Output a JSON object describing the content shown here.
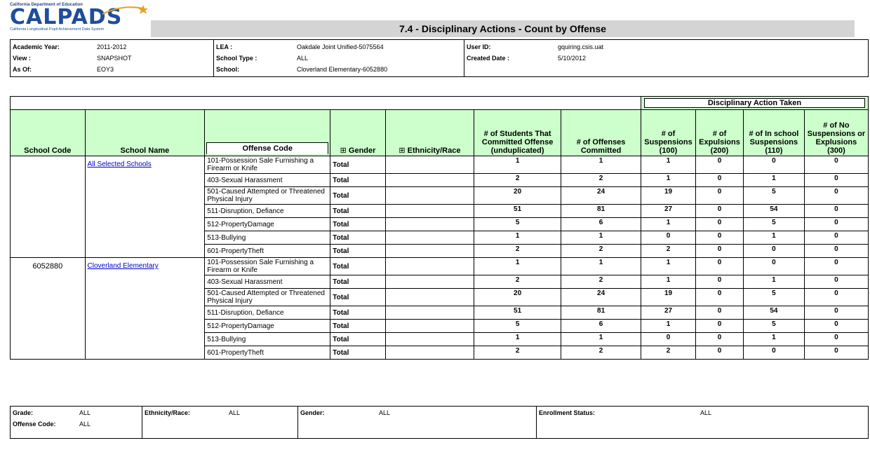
{
  "logo": {
    "dept": "California Department of Education",
    "word": "CALPADS",
    "sub": "California Longitudinal Pupil Achievement Data System"
  },
  "title": "7.4 - Disciplinary Actions - Count by Offense",
  "header": {
    "academic_year_label": "Academic Year:",
    "academic_year": "2011-2012",
    "view_label": "View :",
    "view": "SNAPSHOT",
    "as_of_label": "As Of:",
    "as_of": "EOY3",
    "lea_label": "LEA :",
    "lea": "Oakdale Joint Unified-5075564",
    "school_type_label": "School Type :",
    "school_type": "ALL",
    "school_label": "School:",
    "school": "Cloverland Elementary-6052880",
    "user_id_label": "User ID:",
    "user_id": "gquiring.csis.uat",
    "created_date_label": "Created Date :",
    "created_date": "5/10/2012"
  },
  "columns": {
    "school_code": "School Code",
    "school_name": "School Name",
    "offense_code": "Offense Code",
    "gender": "Gender",
    "ethnicity": "Ethnicity/Race",
    "students": "# of Students That Committed Offense (unduplicated)",
    "offenses": "# of Offenses Committed",
    "suspensions": "# of Suspensions (100)",
    "expulsions": "# of Expulsions (200)",
    "in_school": "# of In school Suspensions (110)",
    "no_susp": "# of No Suspensions or Explusions (300)",
    "group": "Disciplinary Action Taken",
    "expand_icon": "⊞"
  },
  "groups": [
    {
      "school_code": "",
      "school_name": "All Selected Schools",
      "rows": [
        {
          "offense": "101-Possession Sale Furnishing a Firearm or Knife",
          "gender": "Total",
          "students": "1",
          "offenses": "1",
          "suspensions": "1",
          "expulsions": "0",
          "in_school": "0",
          "no_susp": "0"
        },
        {
          "offense": "403-Sexual Harassment",
          "gender": "Total",
          "students": "2",
          "offenses": "2",
          "suspensions": "1",
          "expulsions": "0",
          "in_school": "1",
          "no_susp": "0"
        },
        {
          "offense": "501-Caused Attempted or Threatened Physical Injury",
          "gender": "Total",
          "students": "20",
          "offenses": "24",
          "suspensions": "19",
          "expulsions": "0",
          "in_school": "5",
          "no_susp": "0"
        },
        {
          "offense": "511-Disruption, Defiance",
          "gender": "Total",
          "students": "51",
          "offenses": "81",
          "suspensions": "27",
          "expulsions": "0",
          "in_school": "54",
          "no_susp": "0"
        },
        {
          "offense": "512-PropertyDamage",
          "gender": "Total",
          "students": "5",
          "offenses": "6",
          "suspensions": "1",
          "expulsions": "0",
          "in_school": "5",
          "no_susp": "0"
        },
        {
          "offense": "513-Bullying",
          "gender": "Total",
          "students": "1",
          "offenses": "1",
          "suspensions": "0",
          "expulsions": "0",
          "in_school": "1",
          "no_susp": "0"
        },
        {
          "offense": "601-PropertyTheft",
          "gender": "Total",
          "students": "2",
          "offenses": "2",
          "suspensions": "2",
          "expulsions": "0",
          "in_school": "0",
          "no_susp": "0"
        }
      ]
    },
    {
      "school_code": "6052880",
      "school_name": "Cloverland Elementary",
      "rows": [
        {
          "offense": "101-Possession Sale Furnishing a Firearm or Knife",
          "gender": "Total",
          "students": "1",
          "offenses": "1",
          "suspensions": "1",
          "expulsions": "0",
          "in_school": "0",
          "no_susp": "0"
        },
        {
          "offense": "403-Sexual Harassment",
          "gender": "Total",
          "students": "2",
          "offenses": "2",
          "suspensions": "1",
          "expulsions": "0",
          "in_school": "1",
          "no_susp": "0"
        },
        {
          "offense": "501-Caused Attempted or Threatened Physical Injury",
          "gender": "Total",
          "students": "20",
          "offenses": "24",
          "suspensions": "19",
          "expulsions": "0",
          "in_school": "5",
          "no_susp": "0"
        },
        {
          "offense": "511-Disruption, Defiance",
          "gender": "Total",
          "students": "51",
          "offenses": "81",
          "suspensions": "27",
          "expulsions": "0",
          "in_school": "54",
          "no_susp": "0"
        },
        {
          "offense": "512-PropertyDamage",
          "gender": "Total",
          "students": "5",
          "offenses": "6",
          "suspensions": "1",
          "expulsions": "0",
          "in_school": "5",
          "no_susp": "0"
        },
        {
          "offense": "513-Bullying",
          "gender": "Total",
          "students": "1",
          "offenses": "1",
          "suspensions": "0",
          "expulsions": "0",
          "in_school": "1",
          "no_susp": "0"
        },
        {
          "offense": "601-PropertyTheft",
          "gender": "Total",
          "students": "2",
          "offenses": "2",
          "suspensions": "2",
          "expulsions": "0",
          "in_school": "0",
          "no_susp": "0"
        }
      ]
    }
  ],
  "footer": {
    "grade_label": "Grade:",
    "grade": "ALL",
    "offense_label": "Offense Code:",
    "offense": "ALL",
    "ethnicity_label": "Ethnicity/Race:",
    "ethnicity": "ALL",
    "gender_label": "Gender:",
    "gender": "ALL",
    "enrollment_label": "Enrollment Status:",
    "enrollment": "ALL"
  }
}
